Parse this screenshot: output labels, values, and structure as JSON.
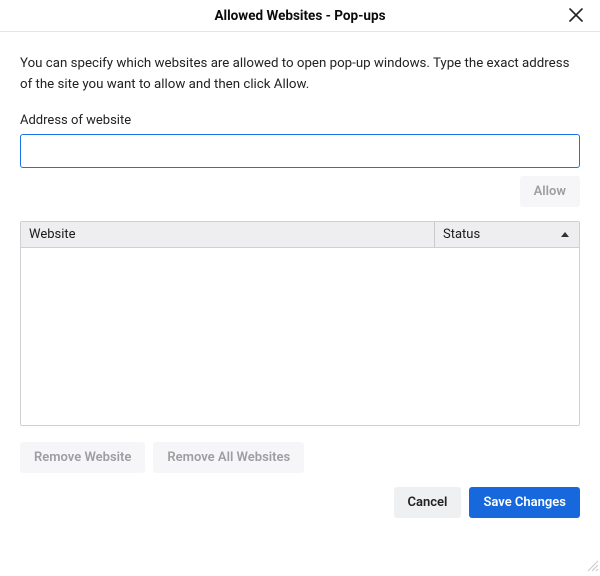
{
  "dialog": {
    "title": "Allowed Websites - Pop-ups",
    "description": "You can specify which websites are allowed to open pop-up windows. Type the exact address of the site you want to allow and then click Allow.",
    "address_label": "Address of website",
    "address_value": "",
    "allow_label": "Allow"
  },
  "grid": {
    "columns": {
      "website": "Website",
      "status": "Status"
    },
    "rows": []
  },
  "buttons": {
    "remove_website": "Remove Website",
    "remove_all": "Remove All Websites",
    "cancel": "Cancel",
    "save": "Save Changes"
  }
}
